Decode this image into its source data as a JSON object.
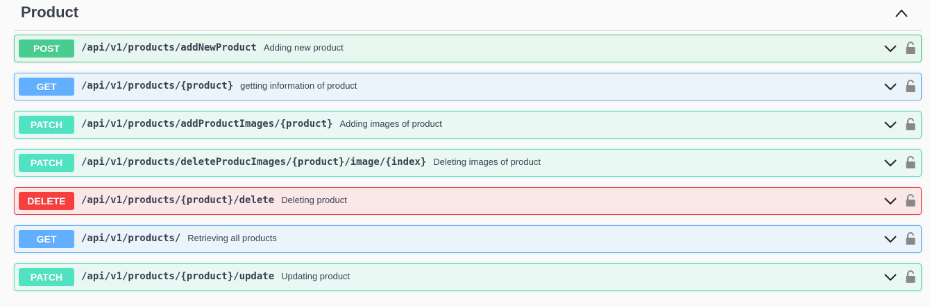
{
  "section": {
    "title": "Product",
    "collapse_icon": "chevron-up-icon"
  },
  "operations": [
    {
      "method": "POST",
      "path": "/api/v1/products/addNewProduct",
      "description": "Adding new product",
      "color": "#49cc90"
    },
    {
      "method": "GET",
      "path": "/api/v1/products/{product}",
      "description": "getting information of product",
      "color": "#61affe"
    },
    {
      "method": "PATCH",
      "path": "/api/v1/products/addProductImages/{product}",
      "description": "Adding images of product",
      "color": "#50e3c2"
    },
    {
      "method": "PATCH",
      "path": "/api/v1/products/deleteProducImages/{product}/image/{index}",
      "description": "Deleting images of product",
      "color": "#50e3c2"
    },
    {
      "method": "DELETE",
      "path": "/api/v1/products/{product}/delete",
      "description": "Deleting product",
      "color": "#f93e3e"
    },
    {
      "method": "GET",
      "path": "/api/v1/products/",
      "description": "Retrieving all products",
      "color": "#61affe"
    },
    {
      "method": "PATCH",
      "path": "/api/v1/products/{product}/update",
      "description": "Updating product",
      "color": "#50e3c2"
    }
  ],
  "icons": {
    "expand": "chevron-down-icon",
    "auth": "lock-icon"
  }
}
